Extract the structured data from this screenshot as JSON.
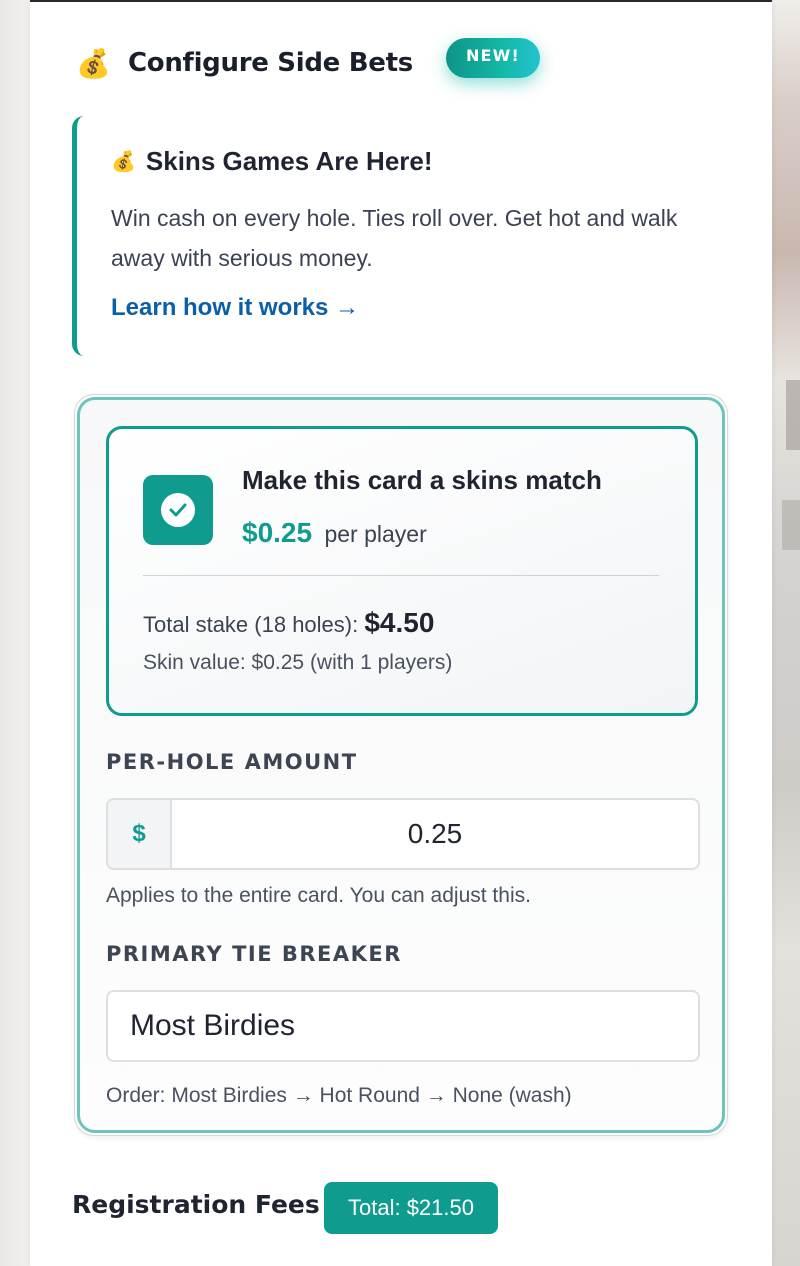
{
  "header": {
    "emoji": "💰",
    "title": "Configure Side Bets",
    "badge": "NEW!"
  },
  "promo": {
    "emoji": "💰",
    "title": "Skins Games Are Here!",
    "description": "Win cash on every hole. Ties roll over. Get hot and walk away with serious money.",
    "link_label": "Learn how it works →"
  },
  "skins": {
    "checkbox_checked": true,
    "match_label": "Make this card a skins match",
    "price_amount": "$0.25",
    "price_suffix": "per player",
    "stake_label": "Total stake (18 holes):",
    "stake_amount": "$4.50",
    "skin_value": "Skin value: $0.25 (with 1 players)",
    "per_hole": {
      "label": "PER-HOLE AMOUNT",
      "prefix": "$",
      "value": "0.25",
      "helper": "Applies to the entire card. You can adjust this."
    },
    "tie_breaker": {
      "label": "PRIMARY TIE BREAKER",
      "selected": "Most Birdies",
      "helper": "Order: Most Birdies → Hot Round → None (wash)"
    }
  },
  "registration": {
    "title": "Registration Fees",
    "total": "Total: $21.50"
  },
  "colors": {
    "accent": "#0f9c8f",
    "link": "#0b5fa8"
  }
}
